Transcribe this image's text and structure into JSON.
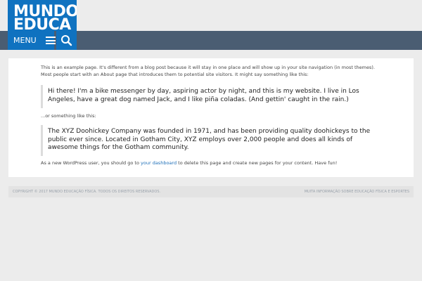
{
  "site": {
    "logo_text": "MUNDO\nEDUCA",
    "menu_label": "MENU",
    "search_icon": "search-icon",
    "menu_icon": "hamburger-icon"
  },
  "colors": {
    "brand_blue": "#0f72c0",
    "nav_bar": "#4a5d72",
    "background": "#ececec",
    "link": "#1e6fb8"
  },
  "content": {
    "intro": "This is an example page. It's different from a blog post because it will stay in one place and will show up in your site navigation (in most themes). Most people start with an About page that introduces them to potential site visitors. It might say something like this:",
    "quote1": "Hi there! I'm a bike messenger by day, aspiring actor by night, and this is my website. I live in Los Angeles, have a great dog named Jack, and I like piña coladas. (And gettin' caught in the rain.)",
    "or_text": "...or something like this:",
    "quote2": "The XYZ Doohickey Company was founded in 1971, and has been providing quality doohickeys to the public ever since. Located in Gotham City, XYZ employs over 2,000 people and does all kinds of awesome things for the Gotham community.",
    "outro_before": "As a new WordPress user, you should go to ",
    "outro_link": "your dashboard",
    "outro_after": " to delete this page and create new pages for your content. Have fun!"
  },
  "footer": {
    "copyright": "COPYRIGHT © 2017 MUNDO EDUCAÇÃO FÍSICA. TODOS OS DIREITOS RESERVADOS.",
    "tagline": "MUITA INFORMAÇÃO SOBRE EDUCAÇÃO FÍSICA E ESPORTES"
  }
}
